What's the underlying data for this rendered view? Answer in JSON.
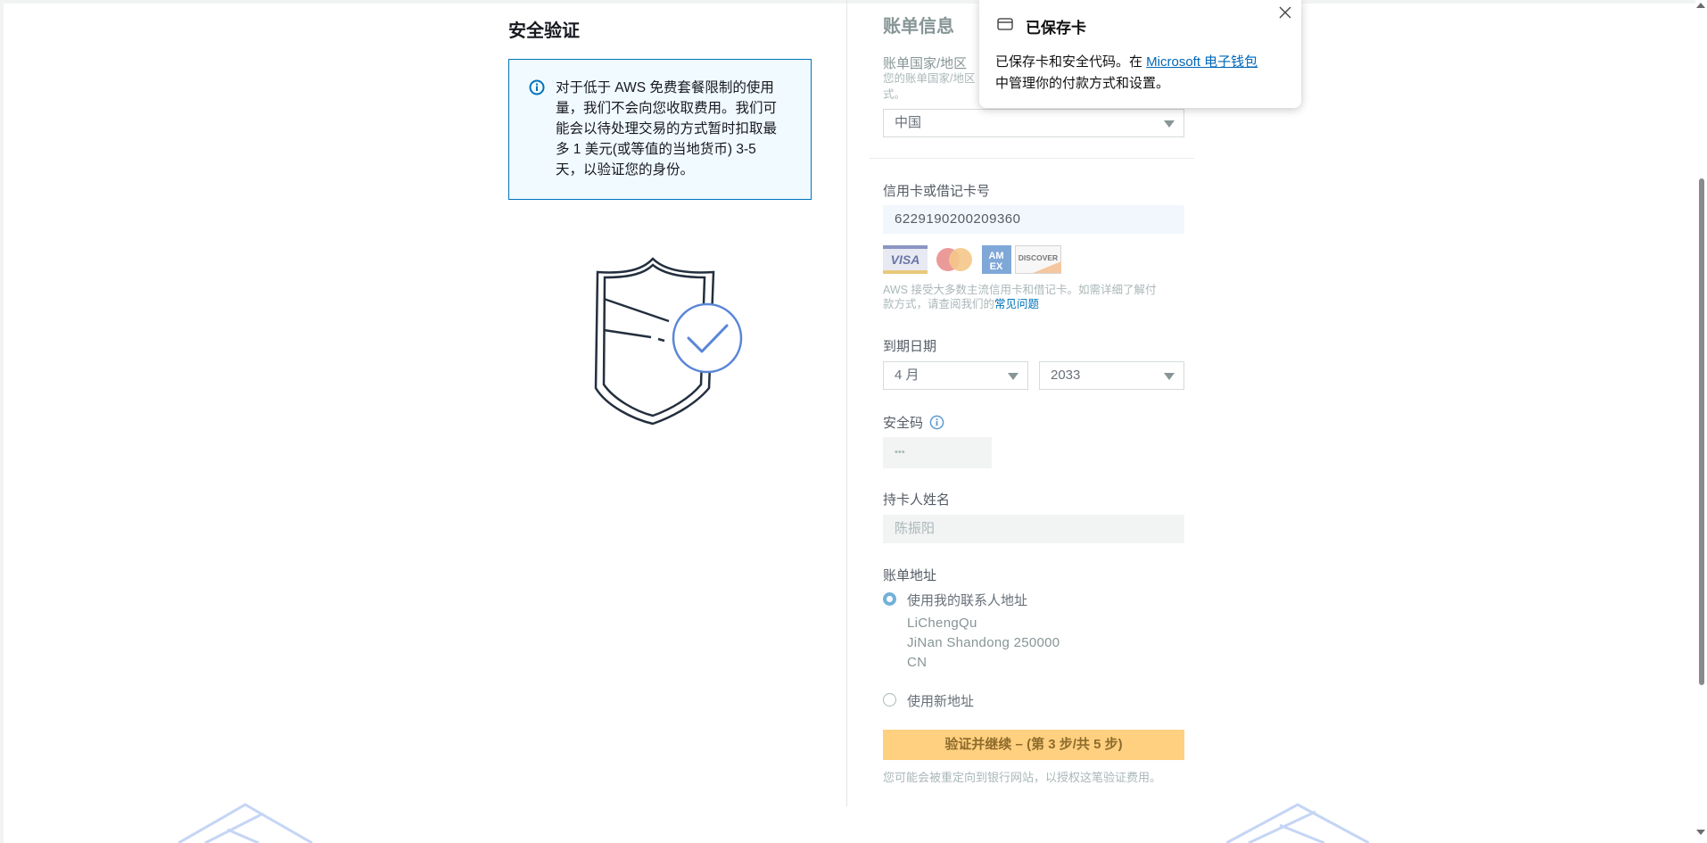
{
  "left": {
    "title": "安全验证",
    "info_text": "对于低于 AWS 免费套餐限制的使用量，我们不会向您收取费用。我们可能会以待处理交易的方式暂时扣取最多 1 美元(或等值的当地货币) 3-5 天，以验证您的身份。"
  },
  "billing": {
    "title": "账单信息",
    "country_label": "账单国家/地区",
    "country_sub_1": "您的账单国家/地区",
    "country_sub_2": "式。",
    "country_value": "中国",
    "card_label": "信用卡或借记卡号",
    "card_value": "6229190200209360",
    "card_logos": [
      "VISA",
      "Mastercard",
      "American Express",
      "DISCOVER"
    ],
    "card_note_1": "AWS 接受大多数主流信用卡和借记卡。如需详细了解付",
    "card_note_2": "款方式，请查阅我们的",
    "card_note_link": "常见问题",
    "expiry_label": "到期日期",
    "expiry_month": "4 月",
    "expiry_year": "2033",
    "cvv_label": "安全码",
    "cvv_placeholder": "•••",
    "name_label": "持卡人姓名",
    "name_value": "陈振阳",
    "address_label": "账单地址",
    "address_option_contact": "使用我的联系人地址",
    "address_lines": [
      "LiChengQu",
      "JiNan Shandong 250000",
      "CN"
    ],
    "address_option_new": "使用新地址",
    "submit_label": "验证并继续 – (第 3 步/共 5 步)",
    "redirect_note": "您可能会被重定向到银行网站，以授权这笔验证费用。"
  },
  "popup": {
    "title": "已保存卡",
    "text_before": "已保存卡和安全代码。在 ",
    "link": "Microsoft 电子钱包",
    "text_after": "中管理你的付款方式和设置。"
  },
  "colors": {
    "accent": "#0073bb",
    "submit_bg": "#ffd07f",
    "info_bg": "#f1faff"
  }
}
